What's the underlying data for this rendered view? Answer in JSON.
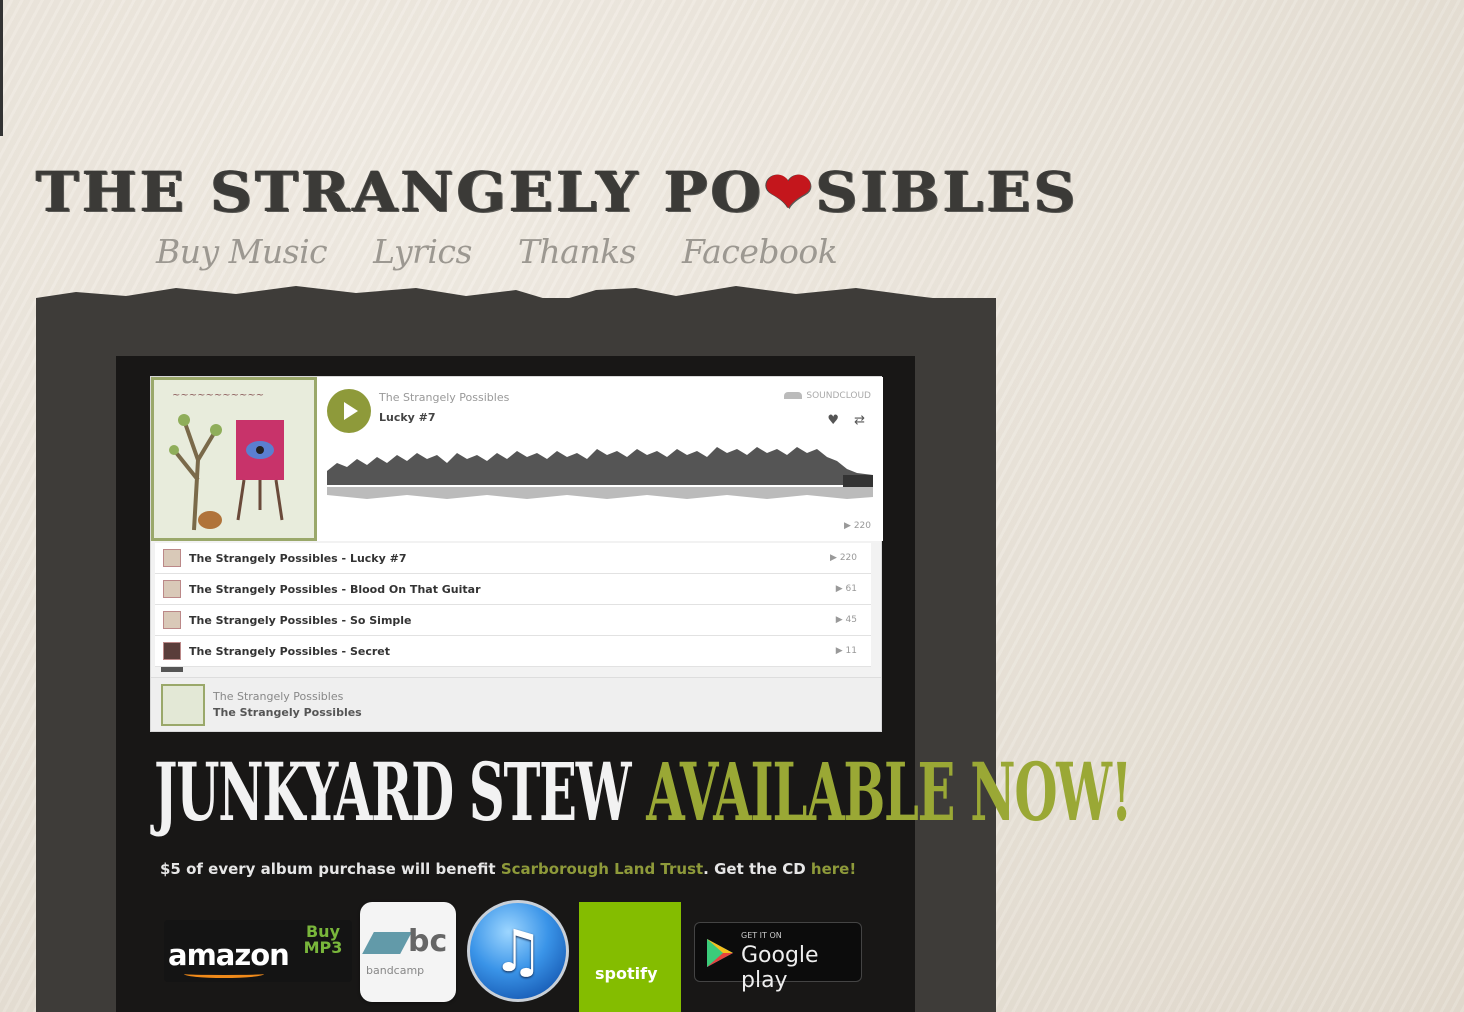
{
  "header": {
    "logo_part1": "THE STRANGELY PO",
    "logo_heart": "❤",
    "logo_part2": "SIBLES"
  },
  "nav": [
    {
      "label": "Buy Music"
    },
    {
      "label": "Lyrics"
    },
    {
      "label": "Thanks"
    },
    {
      "label": "Facebook"
    }
  ],
  "soundcloud": {
    "artist": "The Strangely Possibles",
    "track_title": "Lucky #7",
    "brand": "SOUNDCLOUD",
    "play_count": "▶ 220",
    "tracks": [
      {
        "label": "The Strangely Possibles - Lucky #7",
        "plays": "▶ 220"
      },
      {
        "label": "The Strangely Possibles - Blood On That Guitar",
        "plays": "▶ 61"
      },
      {
        "label": "The Strangely Possibles - So Simple",
        "plays": "▶ 45"
      },
      {
        "label": "The Strangely Possibles - Secret",
        "plays": "▶ 11"
      }
    ],
    "footer_line1": "The Strangely Possibles",
    "footer_line2": "The Strangely Possibles"
  },
  "promo": {
    "headline_white": "JUNKYARD STEW",
    "headline_green": "AVAILABLE NOW!",
    "text_before": "$5 of every album purchase will benefit ",
    "link1": "Scarborough Land Trust",
    "text_mid": ". Get the CD ",
    "link2": "here!"
  },
  "stores": {
    "amazon_word": "amazon",
    "amazon_tag": "Buy MP3",
    "bandcamp_word": "bc",
    "bandcamp_sub": "bandcamp",
    "itunes_glyph": "♫",
    "spotify_word": "spotify",
    "google_top": "GET IT ON",
    "google_main": "Google play"
  },
  "colors": {
    "accent_green": "#9aa835",
    "heart_red": "#c4161c",
    "panel_dark": "#3e3c39"
  }
}
